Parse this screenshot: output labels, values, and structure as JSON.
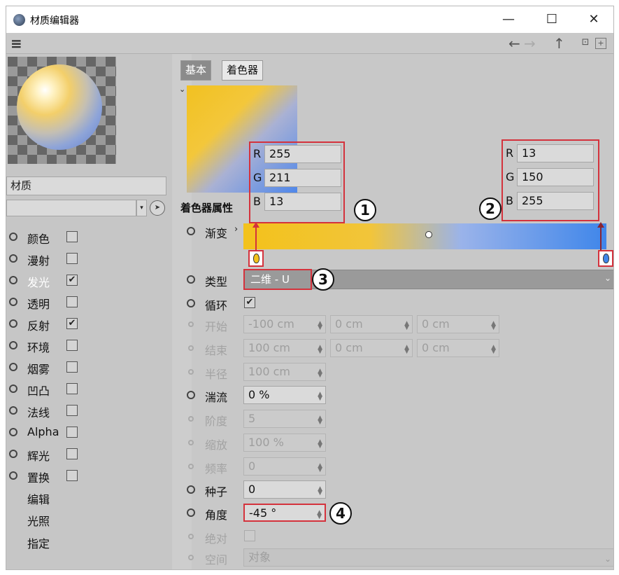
{
  "window": {
    "title": "材质编辑器",
    "minimize": "—",
    "maximize": "☐",
    "close": "✕"
  },
  "toolbar": {
    "menu": "≡",
    "back": "←",
    "forward": "→",
    "up": "↑",
    "lock": "🔒",
    "add": "+"
  },
  "sidebar": {
    "material_name": "材质",
    "channels": [
      {
        "label": "颜色",
        "checked": false
      },
      {
        "label": "漫射",
        "checked": false
      },
      {
        "label": "发光",
        "checked": true
      },
      {
        "label": "透明",
        "checked": false
      },
      {
        "label": "反射",
        "checked": true
      },
      {
        "label": "环境",
        "checked": false
      },
      {
        "label": "烟雾",
        "checked": false
      },
      {
        "label": "凹凸",
        "checked": false
      },
      {
        "label": "法线",
        "checked": false
      },
      {
        "label": "Alpha",
        "checked": false
      },
      {
        "label": "辉光",
        "checked": false
      },
      {
        "label": "置换",
        "checked": false
      }
    ],
    "subitems": [
      "编辑",
      "光照",
      "指定"
    ]
  },
  "tabs": [
    {
      "label": "基本"
    },
    {
      "label": "着色器"
    }
  ],
  "shader": {
    "section_title": "着色器属性",
    "gradient_label": "渐变",
    "rgb_left": {
      "R": "255",
      "G": "211",
      "B": "13"
    },
    "rgb_right": {
      "R": "13",
      "G": "150",
      "B": "255"
    },
    "callouts": [
      "1",
      "2",
      "3",
      "4"
    ],
    "props": {
      "type": {
        "label": "类型",
        "value": "二维 - U"
      },
      "loop": {
        "label": "循环",
        "checked": true
      },
      "start": {
        "label": "开始",
        "x": "-100 cm",
        "y": "0 cm",
        "z": "0 cm"
      },
      "end": {
        "label": "结束",
        "x": "100 cm",
        "y": "0 cm",
        "z": "0 cm"
      },
      "radius": {
        "label": "半径",
        "value": "100 cm"
      },
      "turbulence": {
        "label": "湍流",
        "value": "0 %"
      },
      "octaves": {
        "label": "阶度",
        "value": "5"
      },
      "scale": {
        "label": "缩放",
        "value": "100 %"
      },
      "frequency": {
        "label": "频率",
        "value": "0"
      },
      "seed": {
        "label": "种子",
        "value": "0"
      },
      "angle": {
        "label": "角度",
        "value": "-45 °"
      },
      "absolute": {
        "label": "绝对",
        "checked": false
      },
      "space": {
        "label": "空间",
        "value": "对象"
      }
    }
  },
  "colors": {
    "accent_red": "#d4323c",
    "gradient_start": "#f3c21b",
    "gradient_end": "#3f86ea"
  }
}
